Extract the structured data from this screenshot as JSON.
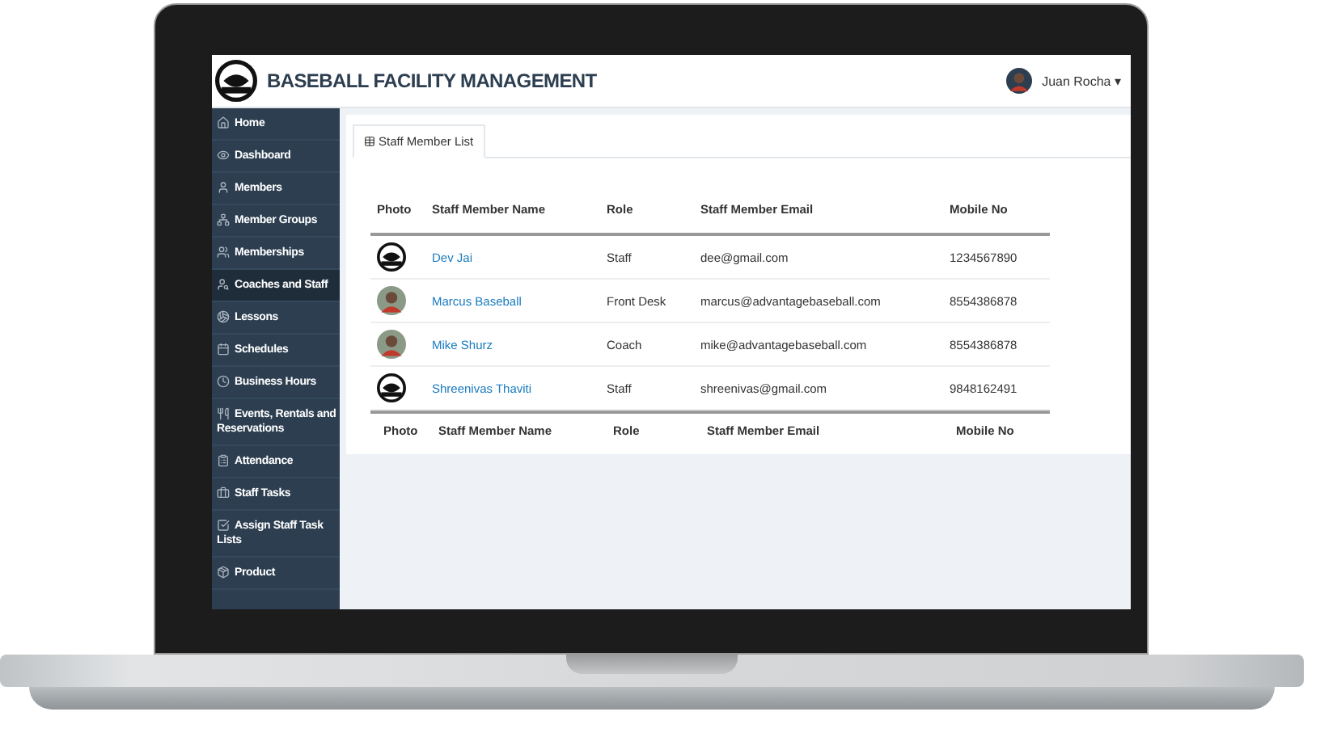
{
  "header": {
    "title": "BASEBALL FACILITY MANAGEMENT",
    "user": {
      "name": "Juan Rocha",
      "caret": "▾"
    }
  },
  "sidebar": {
    "items": [
      {
        "label": "Home",
        "selected": false
      },
      {
        "label": "Dashboard",
        "selected": false
      },
      {
        "label": "Members",
        "selected": false
      },
      {
        "label": "Member Groups",
        "selected": false
      },
      {
        "label": "Memberships",
        "selected": false
      },
      {
        "label": "Coaches and Staff",
        "selected": true
      },
      {
        "label": "Lessons",
        "selected": false
      },
      {
        "label": "Schedules",
        "selected": false
      },
      {
        "label": "Business Hours",
        "selected": false
      },
      {
        "label": "Events, Rentals and Reservations",
        "selected": false
      },
      {
        "label": "Attendance",
        "selected": false
      },
      {
        "label": "Staff Tasks",
        "selected": false
      },
      {
        "label": "Assign Staff Task Lists",
        "selected": false
      },
      {
        "label": "Product",
        "selected": false
      }
    ]
  },
  "tabs": [
    {
      "label": "Staff Member List",
      "selected": true
    }
  ],
  "table": {
    "columns": [
      "Photo",
      "Staff Member Name",
      "Role",
      "Staff Member Email",
      "Mobile No"
    ],
    "rows": [
      {
        "kind": "logo",
        "name": "Dev Jai",
        "role": "Staff",
        "email": "dee@gmail.com",
        "mobile": "1234567890"
      },
      {
        "kind": "avatar",
        "name": "Marcus Baseball",
        "role": "Front Desk",
        "email": "marcus@advantagebaseball.com",
        "mobile": "8554386878"
      },
      {
        "kind": "avatar",
        "name": "Mike Shurz",
        "role": "Coach",
        "email": "mike@advantagebaseball.com",
        "mobile": "8554386878"
      },
      {
        "kind": "logo",
        "name": "Shreenivas Thaviti",
        "role": "Staff",
        "email": "shreenivas@gmail.com",
        "mobile": "9848162491"
      }
    ],
    "footer": [
      "Photo",
      "Staff Member Name",
      "Role",
      "Staff Member Email",
      "Mobile No"
    ]
  }
}
